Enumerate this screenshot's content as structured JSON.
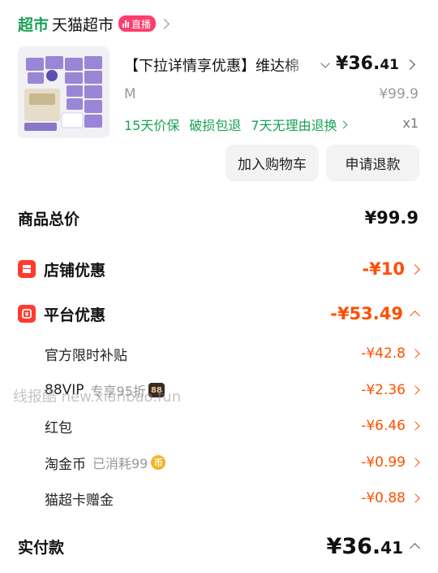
{
  "store": {
    "tag": "超市",
    "name": "天猫超市",
    "live_label": "直播"
  },
  "item": {
    "title": "【下拉详情享优惠】维达棉",
    "price_main": "¥36.",
    "price_cents": "41",
    "sku": "M",
    "original_price": "¥99.9",
    "quantity": "x1",
    "services": [
      "15天价保",
      "破损包退",
      "7天无理由退换"
    ]
  },
  "actions": {
    "add_to_cart": "加入购物车",
    "refund": "申请退款"
  },
  "summary": {
    "total_label": "商品总价",
    "total_value": "¥99.9",
    "shop_discount_label": "店铺优惠",
    "shop_discount_value": "-¥10",
    "platform_discount_label": "平台优惠",
    "platform_discount_value": "-¥53.49",
    "platform_items": [
      {
        "label": "官方限时补贴",
        "note": "",
        "value": "-¥42.8"
      },
      {
        "label": "88VIP",
        "note": "专享95折",
        "badge": "88",
        "value": "-¥2.36"
      },
      {
        "label": "红包",
        "note": "",
        "value": "-¥6.46"
      },
      {
        "label": "淘金币",
        "note": "已消耗99",
        "coin": "币",
        "value": "-¥0.99"
      },
      {
        "label": "猫超卡赠金",
        "note": "",
        "value": "-¥0.88"
      }
    ],
    "paid_label": "实付款",
    "paid_main": "¥36.",
    "paid_cents": "41"
  },
  "watermark": "线报酷 new.xianbao.fun",
  "colors": {
    "green": "#1aa155",
    "orange": "#ff5000",
    "red_icon": "#ff3b30",
    "live_pink": "#ff3d6e"
  }
}
